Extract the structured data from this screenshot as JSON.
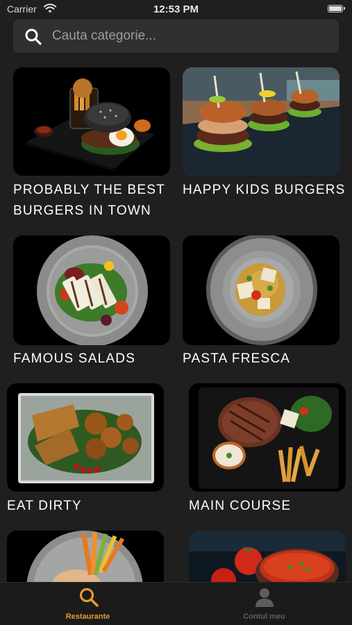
{
  "status_bar": {
    "carrier": "Carrier",
    "time": "12:53 PM"
  },
  "search": {
    "placeholder": "Cauta categorie..."
  },
  "categories": [
    {
      "label_line1": "PROBABLY THE BEST",
      "label_line2": "BURGERS IN TOWN"
    },
    {
      "label": "HAPPY KIDS BURGERS"
    },
    {
      "label": "FAMOUS SALADS"
    },
    {
      "label": "PASTA FRESCA"
    },
    {
      "label": "EAT DIRTY"
    },
    {
      "label": "MAIN COURSE"
    }
  ],
  "tab_bar": {
    "tabs": [
      {
        "label": "Restaurante",
        "icon": "search-icon",
        "active": true
      },
      {
        "label": "Contul meu",
        "icon": "user-icon",
        "active": false
      }
    ]
  },
  "colors": {
    "accent": "#e79a2f",
    "background": "#1f1f20",
    "search_bg": "#303032"
  }
}
